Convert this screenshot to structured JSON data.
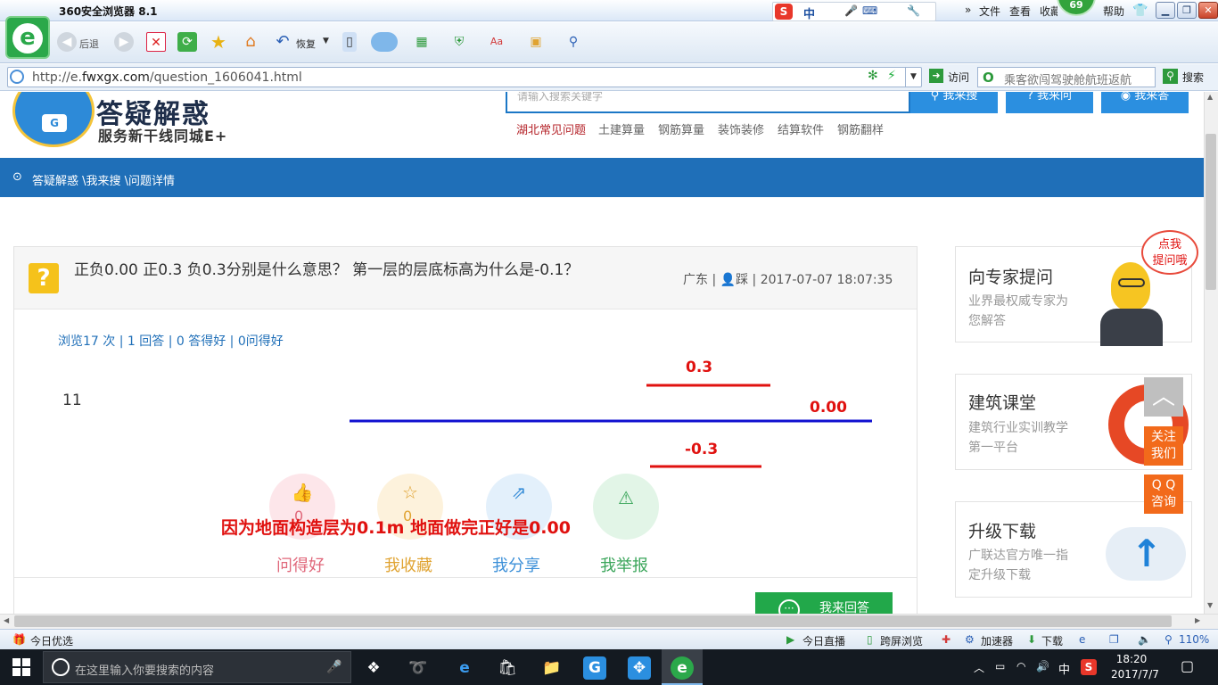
{
  "browser": {
    "title": "360安全浏览器 8.1",
    "menus": [
      "文件",
      "查看",
      "收藏",
      "帮助"
    ],
    "badge": "69",
    "toolbar": {
      "back": "后退",
      "restore": "恢复"
    },
    "ime_label": "中",
    "address": {
      "url_prefix": "http://e.",
      "url_domain": "fwxgx.com",
      "url_path": "/question_1606041.html"
    },
    "visit_label": "访问",
    "search_placeholder": "乘客欲闯驾驶舱航班返航",
    "search_label": "搜索",
    "window_controls": {
      "min": "▁",
      "max": "❐",
      "close": "✕"
    }
  },
  "site": {
    "logo_title": "答疑解惑",
    "slogan": "服务新干线同城E+",
    "search_placeholder": "请输入搜索关键字",
    "search_buttons": [
      "我来搜",
      "我来问",
      "我来答"
    ],
    "quick_links": [
      "湖北常见问题",
      "土建算量",
      "钢筋算量",
      "装饰装修",
      "结算软件",
      "钢筋翻样"
    ],
    "breadcrumb": "答疑解惑 \\我来搜 \\问题详情"
  },
  "question": {
    "icon": "?",
    "title": "正负0.00 正0.3 负0.3分别是什么意思？ 第一层的层底标高为什么是-0.1？",
    "region": "广东",
    "user": "踩",
    "datetime": "2017-07-07 18:07:35",
    "stats": "浏览17 次 | 1 回答 | 0 答得好 | 0问得好",
    "body": "11",
    "sketch_labels": {
      "top": "0.3",
      "middle": "0.00",
      "bottom": "-0.3"
    },
    "explanation": "因为地面构造层为0.1m  地面做完正好是0.00",
    "actions": [
      {
        "label": "问得好",
        "count": "0",
        "color": "#e0677a",
        "bg": "#fde6ea"
      },
      {
        "label": "我收藏",
        "count": "0",
        "color": "#e0a331",
        "bg": "#fdf2dc"
      },
      {
        "label": "我分享",
        "count": "",
        "color": "#3b8fd8",
        "bg": "#e3f0fb"
      },
      {
        "label": "我举报",
        "count": "",
        "color": "#3aa55a",
        "bg": "#e2f5e7"
      }
    ],
    "answer_button": "我来回答"
  },
  "sidebar": {
    "cards": [
      {
        "title": "向专家提问",
        "subtitle": "业界最权威专家为您解答"
      },
      {
        "title": "建筑课堂",
        "subtitle": "建筑行业实训教学第一平台"
      },
      {
        "title": "升级下载",
        "subtitle": "广联达官方唯一指定升级下载"
      }
    ],
    "bubble": "点我\n提问哦",
    "follow": "关注\n我们",
    "qq": "Q Q\n咨询"
  },
  "statusbar": {
    "left": "今日优选",
    "items": [
      "今日直播",
      "跨屏浏览",
      "加速器",
      "下载"
    ],
    "zoom": "110%"
  },
  "taskbar": {
    "search_text": "在这里输入你要搜索的内容",
    "time": "18:20",
    "date": "2017/7/7",
    "ime": "中"
  }
}
